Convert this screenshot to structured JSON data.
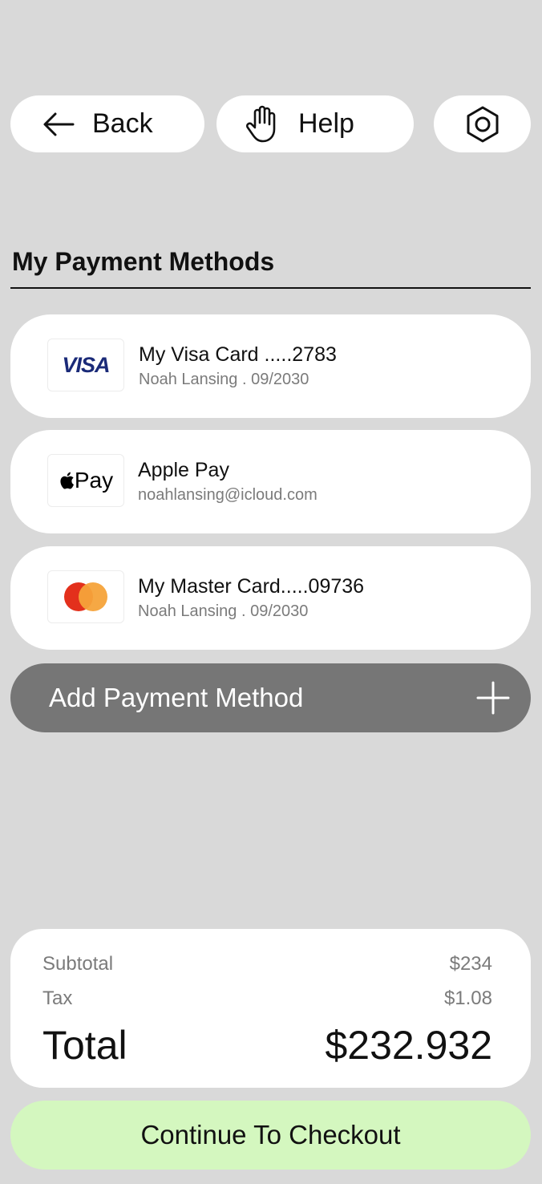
{
  "topbar": {
    "back_label": "Back",
    "help_label": "Help",
    "back_icon": "arrow-left-icon",
    "help_icon": "hand-icon",
    "settings_icon": "settings-hex-icon"
  },
  "section": {
    "title": "My Payment Methods"
  },
  "payment_methods": [
    {
      "logo": "VISA",
      "name": "My Visa Card .....2783",
      "detail": "Noah Lansing . 09/2030"
    },
    {
      "logo": "Pay",
      "name": "Apple Pay",
      "detail": "noahlansing@icloud.com"
    },
    {
      "logo": "mastercard-logo",
      "name": "My Master Card.....09736",
      "detail": "Noah Lansing . 09/2030"
    }
  ],
  "add_method": {
    "label": "Add Payment Method",
    "icon": "plus-icon"
  },
  "summary": {
    "subtotal_label": "Subtotal",
    "subtotal_value": "$234",
    "tax_label": "Tax",
    "tax_value": "$1.08",
    "total_label": "Total",
    "total_value": "$232.932"
  },
  "checkout": {
    "label": "Continue To Checkout"
  },
  "colors": {
    "background": "#d9d9d9",
    "card": "#ffffff",
    "add_button": "#767676",
    "checkout_button": "#d4f7bf",
    "visa_blue": "#1a2a78",
    "mastercard_red": "#e3301c",
    "mastercard_orange": "#f6a33a"
  }
}
